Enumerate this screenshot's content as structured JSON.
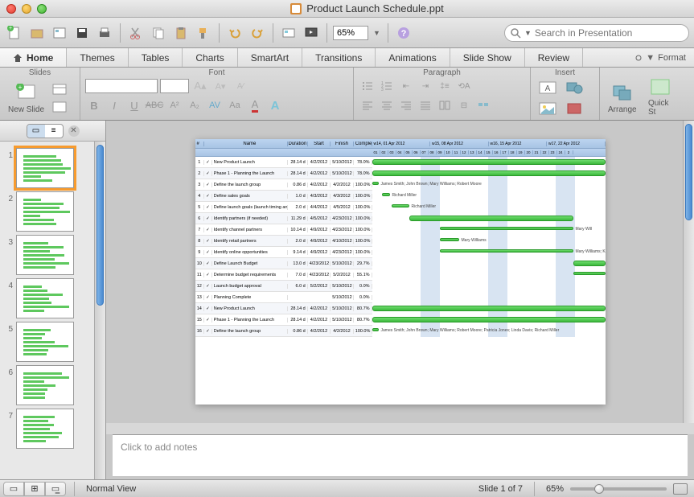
{
  "window": {
    "title": "Product Launch Schedule.ppt"
  },
  "toolbar": {
    "zoom": "65%"
  },
  "search": {
    "placeholder": "Search in Presentation"
  },
  "tabs": [
    "Home",
    "Themes",
    "Tables",
    "Charts",
    "SmartArt",
    "Transitions",
    "Animations",
    "Slide Show",
    "Review"
  ],
  "format_link": "Format",
  "ribbon": {
    "slides": {
      "label": "Slides",
      "new_slide": "New Slide"
    },
    "font": {
      "label": "Font"
    },
    "paragraph": {
      "label": "Paragraph"
    },
    "insert": {
      "label": "Insert"
    },
    "arrange": {
      "label": "Arrange"
    },
    "quick": {
      "label": "Quick St"
    }
  },
  "thumbs": {
    "count": 7,
    "selected": 1
  },
  "notes": {
    "placeholder": "Click to add notes"
  },
  "status": {
    "view": "Normal View",
    "slide": "Slide 1 of 7",
    "zoom": "65%"
  },
  "chart_data": {
    "type": "table",
    "title": "Product Launch Schedule",
    "weeks": [
      "w14, 01 Apr 2012",
      "w15, 08 Apr 2012",
      "w16, 15 Apr 2012",
      "w17, 22 Apr 2012"
    ],
    "days": [
      "01",
      "02",
      "03",
      "04",
      "05",
      "06",
      "07",
      "08",
      "09",
      "10",
      "11",
      "12",
      "13",
      "14",
      "15",
      "16",
      "17",
      "18",
      "19",
      "20",
      "21",
      "22",
      "23",
      "24",
      "2"
    ],
    "columns": [
      "#",
      "",
      "Name",
      "Duration",
      "Start",
      "Finish",
      "Complete"
    ],
    "rows": [
      {
        "n": 1,
        "name": "New Product Launch",
        "dur": "28.14 d",
        "start": "4/2/2012",
        "finish": "5/10/2012",
        "comp": "78.0%",
        "bar": [
          0,
          290
        ],
        "thin": false
      },
      {
        "n": 2,
        "name": "Phase 1 - Planning the Launch",
        "dur": "28.14 d",
        "start": "4/2/2012",
        "finish": "5/10/2012",
        "comp": "78.0%",
        "bar": [
          0,
          290
        ],
        "thin": false
      },
      {
        "n": 3,
        "name": "Define the launch group",
        "dur": "0.86 d",
        "start": "4/2/2012",
        "finish": "4/2/2012",
        "comp": "100.0%",
        "bar": [
          0,
          8
        ],
        "label": "James Smith; John Brown; Mary Williams; Robert Moore",
        "thin": true
      },
      {
        "n": 4,
        "name": "Define sales goals",
        "dur": "1.0 d",
        "start": "4/3/2012",
        "finish": "4/3/2012",
        "comp": "100.0%",
        "bar": [
          12,
          22
        ],
        "label": "Richard Miller",
        "thin": true
      },
      {
        "n": 5,
        "name": "Define launch goals (launch timing and publicity objectives)",
        "dur": "2.0 d",
        "start": "4/4/2012",
        "finish": "4/5/2012",
        "comp": "100.0%",
        "bar": [
          24,
          46
        ],
        "label": "Richard Miller",
        "thin": true
      },
      {
        "n": 6,
        "name": "Identify partners (if needed)",
        "dur": "11.29 d",
        "start": "4/5/2012",
        "finish": "4/23/2012",
        "comp": "100.0%",
        "bar": [
          46,
          250
        ],
        "thin": false
      },
      {
        "n": 7,
        "name": "Identify channel partners",
        "dur": "10.14 d",
        "start": "4/9/2012",
        "finish": "4/23/2012",
        "comp": "100.0%",
        "bar": [
          84,
          250
        ],
        "label": "Mary Will",
        "thin": true
      },
      {
        "n": 8,
        "name": "Identify retail partners",
        "dur": "2.0 d",
        "start": "4/9/2012",
        "finish": "4/10/2012",
        "comp": "100.0%",
        "bar": [
          84,
          108
        ],
        "label": "Mary Williams",
        "thin": true
      },
      {
        "n": 9,
        "name": "Identify online opportunities",
        "dur": "9.14 d",
        "start": "4/9/2012",
        "finish": "4/23/2012",
        "comp": "100.0%",
        "bar": [
          84,
          250
        ],
        "label": "Mary Williams; Karon Ma",
        "thin": true
      },
      {
        "n": 10,
        "name": "Define Launch Budget",
        "dur": "13.0 d",
        "start": "4/23/2012",
        "finish": "5/10/2012",
        "comp": "29.7%",
        "bar": [
          250,
          290
        ],
        "thin": false
      },
      {
        "n": 11,
        "name": "Determine budget requirements",
        "dur": "7.0 d",
        "start": "4/23/2012",
        "finish": "5/2/2012",
        "comp": "55.1%",
        "bar": [
          250,
          290
        ],
        "thin": true
      },
      {
        "n": 12,
        "name": "Launch budget approval",
        "dur": "6.0 d",
        "start": "5/2/2012",
        "finish": "5/10/2012",
        "comp": "0.0%",
        "bar": null,
        "thin": true
      },
      {
        "n": 13,
        "name": "Planning Complete",
        "dur": "",
        "start": "",
        "finish": "5/10/2012",
        "comp": "0.0%",
        "bar": null,
        "thin": true
      },
      {
        "n": 14,
        "name": "New Product Launch",
        "dur": "28.14 d",
        "start": "4/2/2012",
        "finish": "5/10/2012",
        "comp": "80.7%",
        "bar": [
          0,
          290
        ],
        "thin": false
      },
      {
        "n": 15,
        "name": "Phase 1 - Planning the Launch",
        "dur": "28.14 d",
        "start": "4/2/2012",
        "finish": "5/10/2012",
        "comp": "80.7%",
        "bar": [
          0,
          290
        ],
        "thin": false
      },
      {
        "n": 16,
        "name": "Define the launch group",
        "dur": "0.86 d",
        "start": "4/2/2012",
        "finish": "4/2/2012",
        "comp": "100.0%",
        "bar": [
          0,
          8
        ],
        "label": "James Smith; John Brown; Mary Williams; Robert Moore; Patricia Jones; Linda Davis; Richard Miller",
        "thin": true
      }
    ]
  }
}
